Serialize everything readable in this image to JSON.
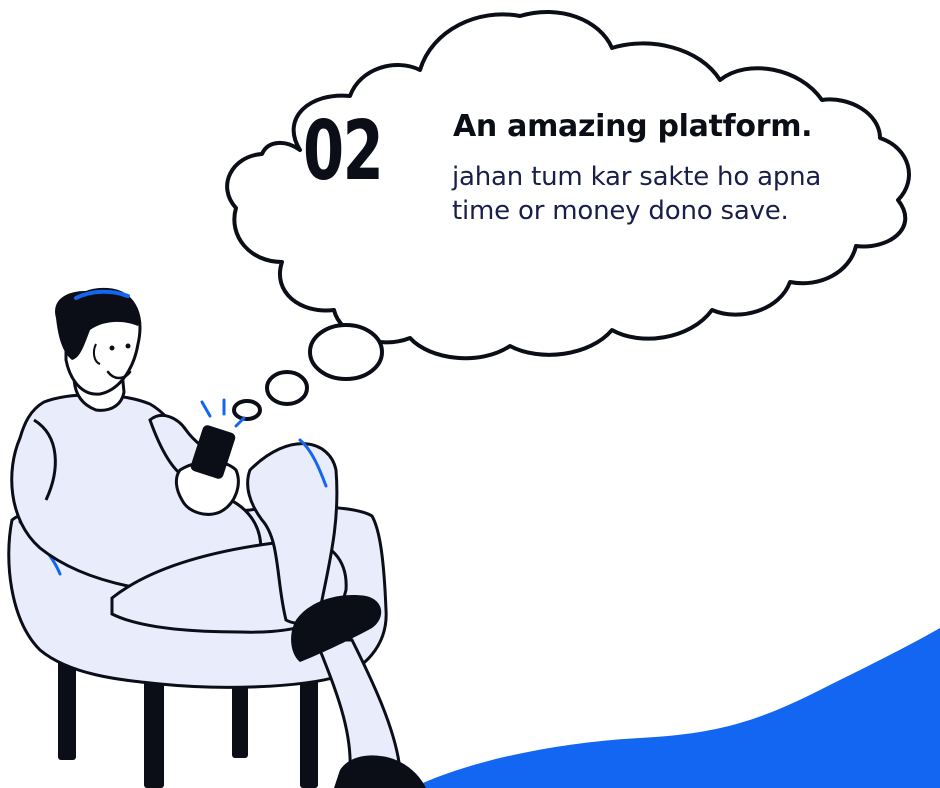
{
  "bubble": {
    "number": "02",
    "headline": "An amazing platform.",
    "body": "jahan tum kar sakte ho apna time or money dono save."
  },
  "illustration": {
    "subject": "man-sitting-in-chair-using-phone-icon",
    "thought": "thought-bubble-icon"
  },
  "colors": {
    "accent": "#1266f1",
    "ink": "#0b0d17",
    "pale": "#e8ecfb",
    "background": "#ffffff"
  }
}
